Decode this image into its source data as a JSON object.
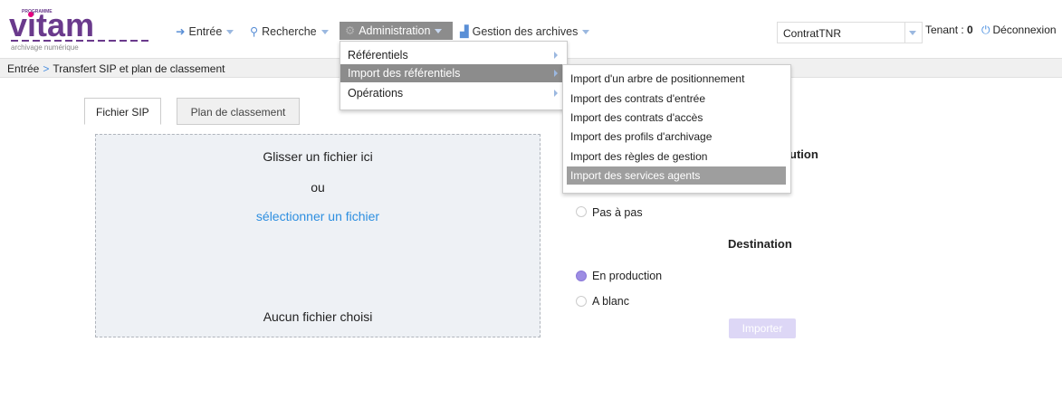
{
  "colors": {
    "accent": "#2e8fe0",
    "menu_active": "#8c8c8c",
    "radio_on": "#9d8de3",
    "import_btn": "#ddd7f6"
  },
  "logo": {
    "small_text": "PROGRAMME",
    "name": "vitam",
    "tagline": "archivage numérique"
  },
  "nav": {
    "entree": {
      "label": "Entrée",
      "icon": "sign-in-icon"
    },
    "recherche": {
      "label": "Recherche",
      "icon": "search-icon"
    },
    "administration": {
      "label": "Administration",
      "icon": "cogs-icon"
    },
    "gestion": {
      "label": "Gestion des archives",
      "icon": "chart-icon"
    }
  },
  "contract": {
    "value": "ContratTNR"
  },
  "tenant": {
    "label": "Tenant : ",
    "value": "0"
  },
  "logout": {
    "label": "Déconnexion",
    "icon": "power-icon"
  },
  "breadcrumb": {
    "root": "Entrée",
    "current": "Transfert SIP et plan de classement"
  },
  "tabs": {
    "sip": "Fichier SIP",
    "plan": "Plan de classement"
  },
  "dropzone": {
    "drag": "Glisser un fichier ici",
    "or": "ou",
    "select": "sélectionner un fichier",
    "status": "Aucun fichier choisi"
  },
  "execution": {
    "heading_fragment": "ution",
    "step_label": "Pas à pas"
  },
  "destination": {
    "heading": "Destination",
    "options": [
      "En production",
      "A blanc"
    ],
    "selected": "En production"
  },
  "import_button": "Importer",
  "admin_menu": [
    "Référentiels",
    "Import des référentiels",
    "Opérations"
  ],
  "import_submenu": [
    "Import d'un arbre de positionnement",
    "Import des contrats d'entrée",
    "Import des contrats d'accès",
    "Import des profils d'archivage",
    "Import des règles de gestion",
    "Import des services agents"
  ]
}
